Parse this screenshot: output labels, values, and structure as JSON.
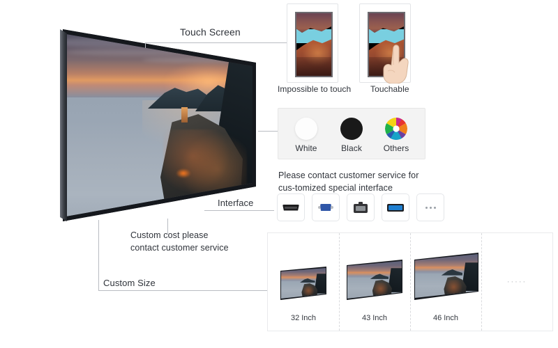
{
  "meta": {
    "background": "#ffffff",
    "line_color": "#b9bcc2",
    "text_color": "#2f333a",
    "panel_bg": "#f3f3f3",
    "card_bg": "#ffffff"
  },
  "callouts": {
    "touch_screen": "Touch Screen",
    "interface": "Interface",
    "custom_cost": "Custom cost please\ncontact customer service",
    "custom_cost_line1": "Custom cost please",
    "custom_cost_line2": "contact customer service",
    "custom_size": "Custom Size"
  },
  "touch_options": [
    {
      "label": "Impossible to touch",
      "has_hand": false
    },
    {
      "label": "Touchable",
      "has_hand": true
    }
  ],
  "colors": {
    "options": [
      {
        "label": "White",
        "swatch": "#fdfdfd",
        "type": "solid"
      },
      {
        "label": "Black",
        "swatch": "#191919",
        "type": "solid"
      },
      {
        "label": "Others",
        "swatch": "multicolor",
        "type": "wheel"
      }
    ],
    "wheel_segments": [
      "#e8352e",
      "#f07f1a",
      "#f5d315",
      "#8dc63f",
      "#1fb14b",
      "#18a3c8",
      "#2b58b0",
      "#6c3fa0",
      "#c72a8e"
    ]
  },
  "interface": {
    "note_line1": "Please contact customer service for",
    "note_line2": "cus-tomized special interface",
    "ports": [
      {
        "name": "hdmi-port-icon",
        "type": "hdmi"
      },
      {
        "name": "vga-port-icon",
        "type": "vga"
      },
      {
        "name": "rj45-port-icon",
        "type": "rj45"
      },
      {
        "name": "usb-port-icon",
        "type": "usb"
      },
      {
        "name": "more-ports-icon",
        "type": "ellipsis"
      }
    ]
  },
  "sizes": {
    "items": [
      {
        "label": "32 Inch",
        "scale": 0.62
      },
      {
        "label": "43 Inch",
        "scale": 0.8
      },
      {
        "label": "46 Inch",
        "scale": 1.0
      }
    ],
    "more_placeholder": "·····"
  },
  "main_display": {
    "name": "main-tv-display",
    "image_subject": "coastal sunset village"
  }
}
